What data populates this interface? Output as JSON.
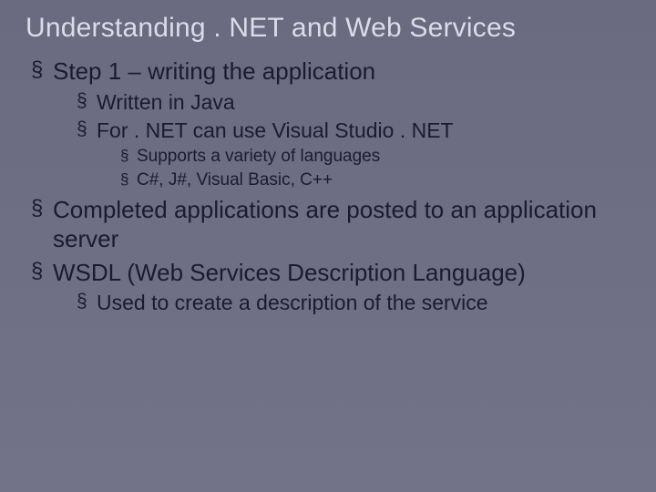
{
  "title": "Understanding . NET and Web Services",
  "bullets": {
    "b1": "Step 1 – writing the application",
    "b1_1": "Written in Java",
    "b1_2": "For . NET can use Visual Studio . NET",
    "b1_2_1": "Supports a variety of languages",
    "b1_2_2": "C#, J#, Visual Basic, C++",
    "b2": "Completed applications are posted to an application server",
    "b3": "WSDL (Web Services Description Language)",
    "b3_1": "Used to create a description of the service"
  }
}
